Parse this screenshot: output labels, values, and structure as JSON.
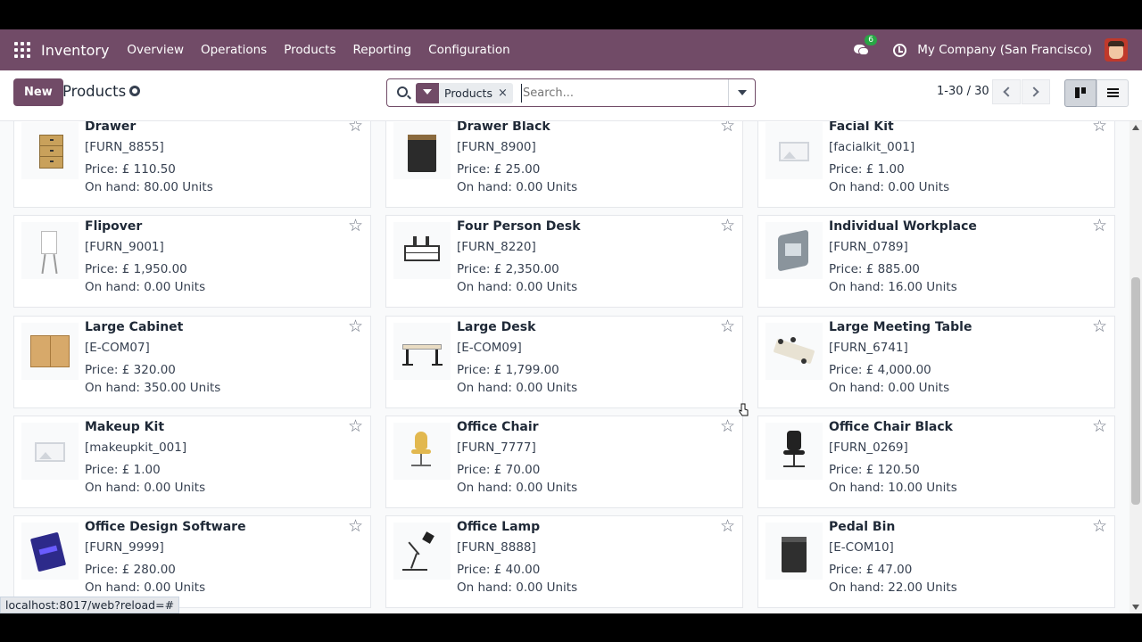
{
  "navbar": {
    "app_name": "Inventory",
    "menu": [
      "Overview",
      "Operations",
      "Products",
      "Reporting",
      "Configuration"
    ],
    "chat_badge": "6",
    "company": "My Company (San Francisco)"
  },
  "control_panel": {
    "new_label": "New",
    "title": "Products",
    "facet_label": "Products",
    "facet_remove": "×",
    "search_placeholder": "Search...",
    "pager": "1-30 / 30"
  },
  "products": [
    {
      "name": "Drawer",
      "code": "[FURN_8855]",
      "price": "Price: £ 110.50",
      "on_hand": "On hand: 80.00 Units",
      "image": "drawer-image"
    },
    {
      "name": "Drawer Black",
      "code": "[FURN_8900]",
      "price": "Price: £ 25.00",
      "on_hand": "On hand: 0.00 Units",
      "image": "drawer-black-image"
    },
    {
      "name": "Facial Kit",
      "code": "[facialkit_001]",
      "price": "Price: £ 1.00",
      "on_hand": "On hand: 0.00 Units",
      "image": "placeholder-image"
    },
    {
      "name": "Flipover",
      "code": "[FURN_9001]",
      "price": "Price: £ 1,950.00",
      "on_hand": "On hand: 0.00 Units",
      "image": "flipover-image"
    },
    {
      "name": "Four Person Desk",
      "code": "[FURN_8220]",
      "price": "Price: £ 2,350.00",
      "on_hand": "On hand: 0.00 Units",
      "image": "four-person-desk-image"
    },
    {
      "name": "Individual Workplace",
      "code": "[FURN_0789]",
      "price": "Price: £ 885.00",
      "on_hand": "On hand: 16.00 Units",
      "image": "workplace-image"
    },
    {
      "name": "Large Cabinet",
      "code": "[E-COM07]",
      "price": "Price: £ 320.00",
      "on_hand": "On hand: 350.00 Units",
      "image": "cabinet-image"
    },
    {
      "name": "Large Desk",
      "code": "[E-COM09]",
      "price": "Price: £ 1,799.00",
      "on_hand": "On hand: 0.00 Units",
      "image": "desk-image"
    },
    {
      "name": "Large Meeting Table",
      "code": "[FURN_6741]",
      "price": "Price: £ 4,000.00",
      "on_hand": "On hand: 0.00 Units",
      "image": "meeting-table-image"
    },
    {
      "name": "Makeup Kit",
      "code": "[makeupkit_001]",
      "price": "Price: £ 1.00",
      "on_hand": "On hand: 0.00 Units",
      "image": "placeholder-image"
    },
    {
      "name": "Office Chair",
      "code": "[FURN_7777]",
      "price": "Price: £ 70.00",
      "on_hand": "On hand: 0.00 Units",
      "image": "chair-image"
    },
    {
      "name": "Office Chair Black",
      "code": "[FURN_0269]",
      "price": "Price: £ 120.50",
      "on_hand": "On hand: 10.00 Units",
      "image": "chair-black-image"
    },
    {
      "name": "Office Design Software",
      "code": "[FURN_9999]",
      "price": "Price: £ 280.00",
      "on_hand": "On hand: 0.00 Units",
      "image": "software-box-image"
    },
    {
      "name": "Office Lamp",
      "code": "[FURN_8888]",
      "price": "Price: £ 40.00",
      "on_hand": "On hand: 0.00 Units",
      "image": "lamp-image"
    },
    {
      "name": "Pedal Bin",
      "code": "[E-COM10]",
      "price": "Price: £ 47.00",
      "on_hand": "On hand: 22.00 Units",
      "image": "bin-image"
    }
  ],
  "status_url": "localhost:8017/web?reload=#",
  "colors": {
    "brand": "#714b67",
    "badge": "#28a745"
  }
}
